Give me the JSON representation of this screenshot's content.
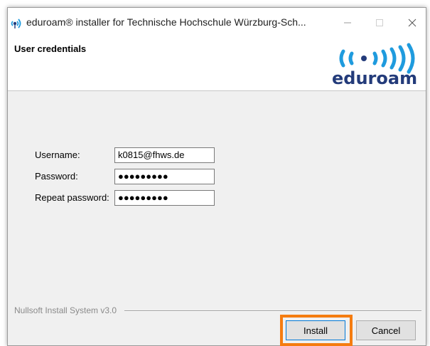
{
  "window": {
    "title": "eduroam® installer for Technische Hochschule Würzburg-Sch..."
  },
  "header": {
    "title": "User credentials",
    "logo_text": "eduroam"
  },
  "form": {
    "username_label": "Username:",
    "username_value": "k0815@fhws.de",
    "password_label": "Password:",
    "password_value": "●●●●●●●●●",
    "repeat_label": "Repeat password:",
    "repeat_value": "●●●●●●●●●"
  },
  "footer": {
    "branding": "Nullsoft Install System v3.0",
    "install_label": "Install",
    "cancel_label": "Cancel"
  },
  "colors": {
    "highlight": "#f57c10",
    "logo_blue": "#1f9bde",
    "logo_dark": "#233b7a"
  }
}
